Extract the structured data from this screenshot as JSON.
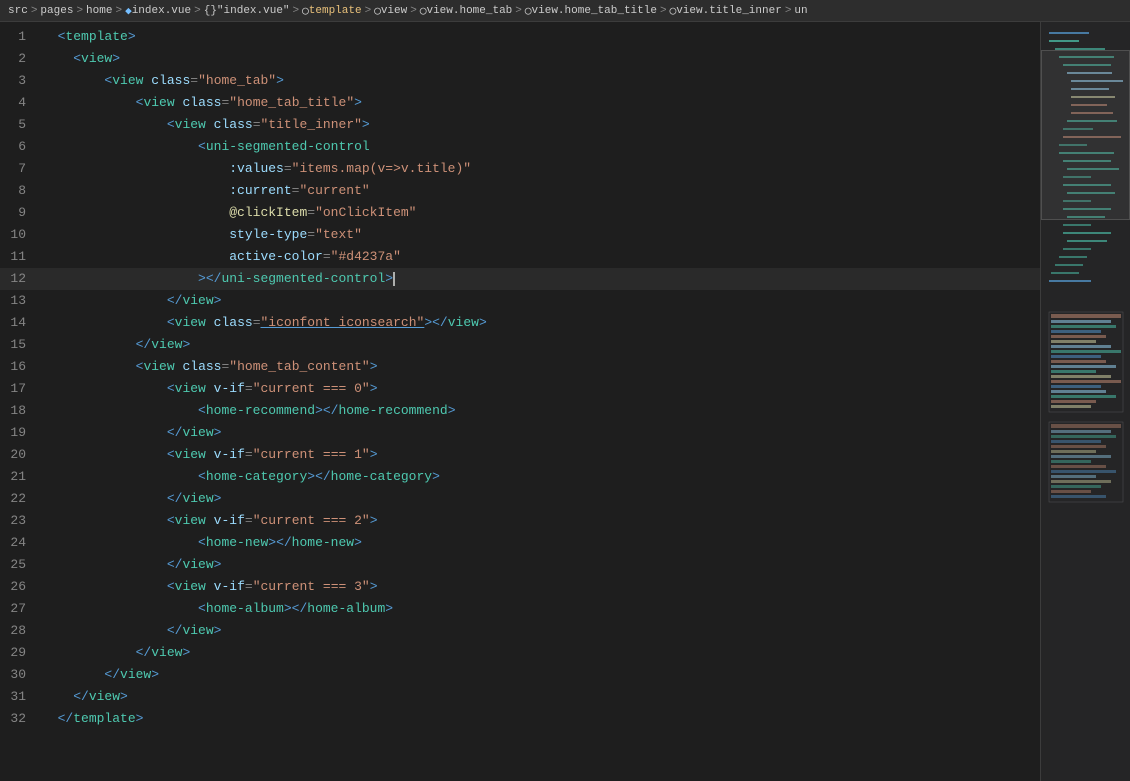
{
  "breadcrumb": {
    "items": [
      {
        "label": "src",
        "type": "text"
      },
      {
        "label": ">",
        "type": "sep"
      },
      {
        "label": "pages",
        "type": "text"
      },
      {
        "label": ">",
        "type": "sep"
      },
      {
        "label": "home",
        "type": "text"
      },
      {
        "label": ">",
        "type": "sep"
      },
      {
        "label": "V",
        "type": "icon",
        "icon": "vue-icon"
      },
      {
        "label": "index.vue",
        "type": "text"
      },
      {
        "label": ">",
        "type": "sep"
      },
      {
        "label": "{}",
        "type": "icon"
      },
      {
        "label": "\"index.vue\"",
        "type": "text"
      },
      {
        "label": ">",
        "type": "sep"
      },
      {
        "label": "template",
        "type": "highlighted"
      },
      {
        "label": ">",
        "type": "sep"
      },
      {
        "label": "view",
        "type": "text"
      },
      {
        "label": ">",
        "type": "sep"
      },
      {
        "label": "view.home_tab",
        "type": "text"
      },
      {
        "label": ">",
        "type": "sep"
      },
      {
        "label": "view.home_tab_title",
        "type": "text"
      },
      {
        "label": ">",
        "type": "sep"
      },
      {
        "label": "view.title_inner",
        "type": "text"
      },
      {
        "label": ">",
        "type": "sep"
      },
      {
        "label": "un",
        "type": "text"
      }
    ]
  },
  "lines": [
    {
      "num": 1,
      "indent": 2,
      "content": "<template>",
      "type": "tag-line",
      "tag": "template",
      "open": true
    },
    {
      "num": 2,
      "indent": 4,
      "content": "<view>",
      "type": "tag-line",
      "tag": "view",
      "open": true
    },
    {
      "num": 3,
      "indent": 8,
      "content": "<view class=\"home_tab\">"
    },
    {
      "num": 4,
      "indent": 12,
      "content": "<view class=\"home_tab_title\">"
    },
    {
      "num": 5,
      "indent": 16,
      "content": "<view class=\"title_inner\">"
    },
    {
      "num": 6,
      "indent": 20,
      "content": "<uni-segmented-control"
    },
    {
      "num": 7,
      "indent": 24,
      "content": ":values=\"items.map(v=>v.title)\""
    },
    {
      "num": 8,
      "indent": 24,
      "content": ":current=\"current\""
    },
    {
      "num": 9,
      "indent": 24,
      "content": "@clickItem=\"onClickItem\""
    },
    {
      "num": 10,
      "indent": 24,
      "content": "style-type=\"text\""
    },
    {
      "num": 11,
      "indent": 24,
      "content": "active-color=\"#d4237a\""
    },
    {
      "num": 12,
      "indent": 20,
      "content": "></uni-segmented-control>",
      "cursor": true
    },
    {
      "num": 13,
      "indent": 16,
      "content": "</view>"
    },
    {
      "num": 14,
      "indent": 16,
      "content": "<view class=\"iconfont iconsearch\"></view>"
    },
    {
      "num": 15,
      "indent": 12,
      "content": "</view>"
    },
    {
      "num": 16,
      "indent": 12,
      "content": "<view class=\"home_tab_content\">"
    },
    {
      "num": 17,
      "indent": 16,
      "content": "<view v-if=\"current === 0\">"
    },
    {
      "num": 18,
      "indent": 20,
      "content": "<home-recommend></home-recommend>"
    },
    {
      "num": 19,
      "indent": 16,
      "content": "</view>"
    },
    {
      "num": 20,
      "indent": 16,
      "content": "<view v-if=\"current === 1\">"
    },
    {
      "num": 21,
      "indent": 20,
      "content": "<home-category></home-category>"
    },
    {
      "num": 22,
      "indent": 16,
      "content": "</view>"
    },
    {
      "num": 23,
      "indent": 16,
      "content": "<view v-if=\"current === 2\">"
    },
    {
      "num": 24,
      "indent": 20,
      "content": "<home-new></home-new>"
    },
    {
      "num": 25,
      "indent": 16,
      "content": "</view>"
    },
    {
      "num": 26,
      "indent": 16,
      "content": "<view v-if=\"current === 3\">"
    },
    {
      "num": 27,
      "indent": 20,
      "content": "<home-album></home-album>"
    },
    {
      "num": 28,
      "indent": 16,
      "content": "</view>"
    },
    {
      "num": 29,
      "indent": 12,
      "content": "</view>"
    },
    {
      "num": 30,
      "indent": 8,
      "content": "</view>"
    },
    {
      "num": 31,
      "indent": 4,
      "content": "</view>"
    },
    {
      "num": 32,
      "indent": 2,
      "content": "</template>"
    }
  ]
}
